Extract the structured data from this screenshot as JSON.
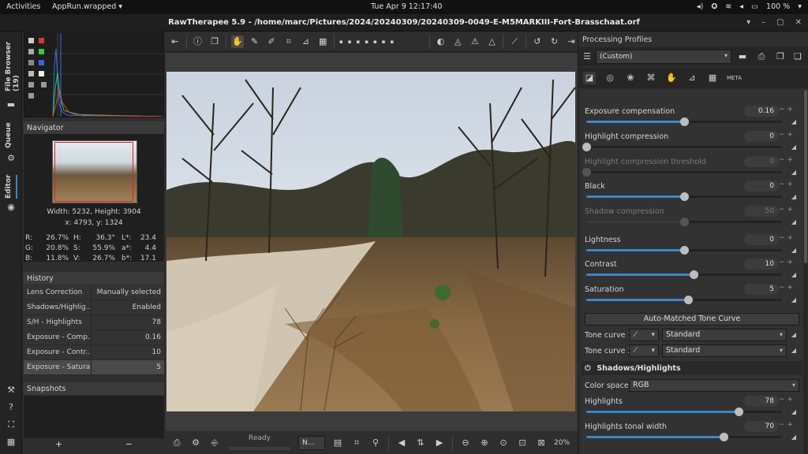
{
  "topbar": {
    "activities": "Activities",
    "app_menu": "AppRun.wrapped ▾",
    "clock": "Tue Apr 9  12:17:40",
    "battery": "100 %"
  },
  "window": {
    "title": "RawTherapee 5.9 - /home/marc/Pictures/2024/20240309/20240309-0049-E-M5MARKIII-Fort-Brasschaat.orf"
  },
  "vtabs": {
    "file_browser": "File Browser (19)",
    "queue": "Queue",
    "editor": "Editor"
  },
  "navigator": {
    "header": "Navigator",
    "size": "Width: 5232, Height: 3904",
    "coords": "x: 4793, y: 1324",
    "info": [
      {
        "k1": "R:",
        "v1": "26.7%",
        "k2": "H:",
        "v2": "36.3°",
        "k3": "L*:",
        "v3": "23.4"
      },
      {
        "k1": "G:",
        "v1": "20.8%",
        "k2": "S:",
        "v2": "55.9%",
        "k3": "a*:",
        "v3": "4.4"
      },
      {
        "k1": "B:",
        "v1": "11.8%",
        "k2": "V:",
        "v2": "26.7%",
        "k3": "b*:",
        "v3": "17.1"
      }
    ]
  },
  "history": {
    "header": "History",
    "rows": [
      {
        "name": "Lens Correction",
        "value": "Manually selected"
      },
      {
        "name": "Shadows/Highlig...",
        "value": "Enabled"
      },
      {
        "name": "S/H - Highlights",
        "value": "78"
      },
      {
        "name": "Exposure - Comp...",
        "value": "0.16"
      },
      {
        "name": "Exposure - Contr...",
        "value": "10"
      },
      {
        "name": "Exposure - Satura...",
        "value": "5"
      }
    ]
  },
  "snapshots": {
    "header": "Snapshots",
    "add": "+",
    "remove": "−"
  },
  "bottombar": {
    "status": "Ready",
    "preview_mode": "N...",
    "zoom": "20%"
  },
  "rightpanel": {
    "title": "Processing Profiles",
    "profile": "(Custom)",
    "exposure": [
      {
        "label": "Exposure compensation",
        "value": "0.16",
        "pos": 0.5,
        "disabled": false
      },
      {
        "label": "Highlight compression",
        "value": "0",
        "pos": 0.0,
        "disabled": false
      },
      {
        "label": "Highlight compression threshold",
        "value": "0",
        "pos": 0.0,
        "disabled": true
      },
      {
        "label": "Black",
        "value": "0",
        "pos": 0.5,
        "disabled": false
      },
      {
        "label": "Shadow compression",
        "value": "50",
        "pos": 0.5,
        "disabled": true
      },
      {
        "label": "Lightness",
        "value": "0",
        "pos": 0.5,
        "disabled": false
      },
      {
        "label": "Contrast",
        "value": "10",
        "pos": 0.55,
        "disabled": false
      },
      {
        "label": "Saturation",
        "value": "5",
        "pos": 0.52,
        "disabled": false
      }
    ],
    "auto_tc": "Auto-Matched Tone Curve",
    "tone_curve_1": {
      "label": "Tone curve 1:",
      "value": "Standard"
    },
    "tone_curve_2": {
      "label": "Tone curve 2:",
      "value": "Standard"
    },
    "sh_header": "Shadows/Highlights",
    "color_space": {
      "label": "Color space:",
      "value": "RGB"
    },
    "sh": [
      {
        "label": "Highlights",
        "value": "78",
        "pos": 0.78,
        "disabled": false
      },
      {
        "label": "Highlights tonal width",
        "value": "70",
        "pos": 0.7,
        "disabled": false
      }
    ]
  }
}
